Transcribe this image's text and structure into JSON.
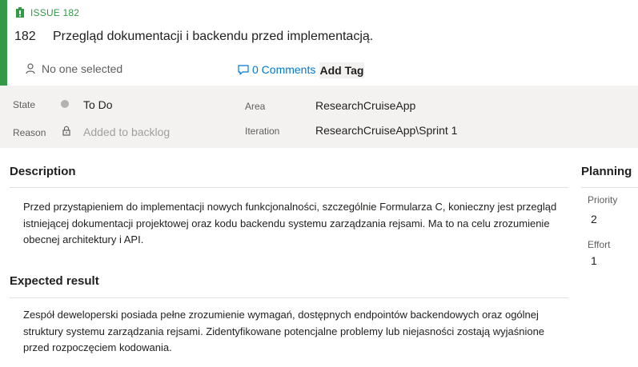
{
  "header": {
    "type_label": "ISSUE 182",
    "id": "182",
    "title": "Przegląd dokumentacji i backendu przed implementacją.",
    "assigned_to": "No one selected",
    "comments_label": "0 Comments",
    "add_tag_label": "Add Tag"
  },
  "fields": {
    "state_label": "State",
    "state_value": "To Do",
    "reason_label": "Reason",
    "reason_value": "Added to backlog",
    "area_label": "Area",
    "area_value": "ResearchCruiseApp",
    "iteration_label": "Iteration",
    "iteration_value": "ResearchCruiseApp\\Sprint 1"
  },
  "description": {
    "title": "Description",
    "text": "Przed przystąpieniem do implementacji nowych funkcjonalności, szczególnie Formularza C, konieczny jest przegląd istniejącej dokumentacji projektowej oraz kodu backendu systemu zarządzania rejsami. Ma to na celu zrozumienie obecnej architektury i API."
  },
  "expected": {
    "title": "Expected result",
    "text": "Zespół deweloperski posiada pełne zrozumienie wymagań, dostępnych endpointów backendowych oraz ogólnej struktury systemu zarządzania rejsami. Zidentyfikowane potencjalne problemy lub niejasności zostają wyjaśnione przed rozpoczęciem kodowania."
  },
  "planning": {
    "title": "Planning",
    "priority_label": "Priority",
    "priority_value": "2",
    "effort_label": "Effort",
    "effort_value": "1"
  },
  "colors": {
    "accent": "#339947",
    "link": "#0078d4",
    "band": "#f3f2f1"
  },
  "icons": [
    "issue-type-icon",
    "person-icon",
    "comment-icon",
    "state-dot-icon",
    "lock-icon"
  ]
}
